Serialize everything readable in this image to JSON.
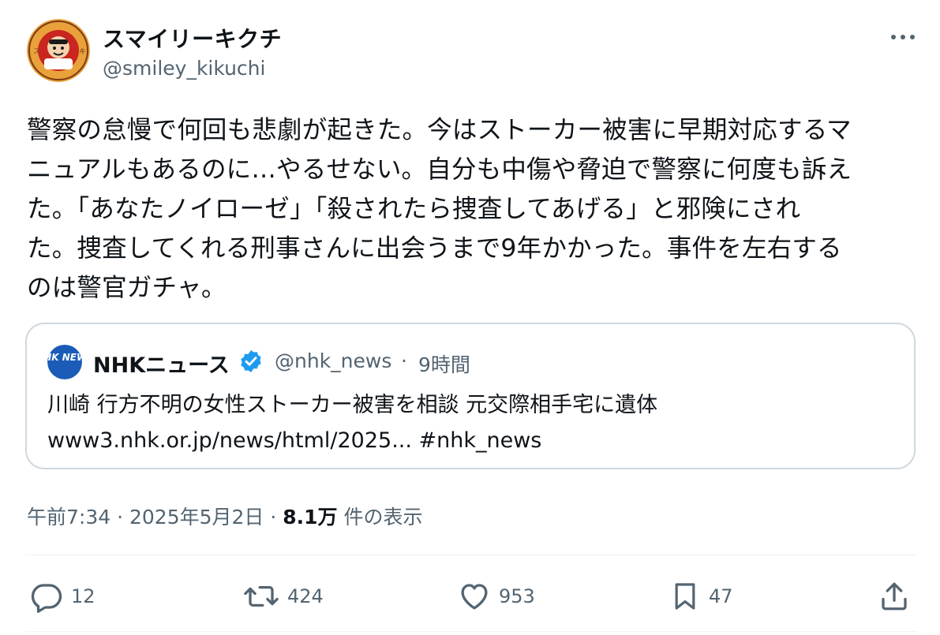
{
  "author": {
    "name": "スマイリーキクチ",
    "handle": "@smiley_kikuchi"
  },
  "tweet": {
    "text": "警察の怠慢で何回も悲劇が起きた。今はストーカー被害に早期対応するマ\nニュアルもあるのに…やるせない。自分も中傷や脅迫で警察に何度も訴え\nた。「あなたノイローゼ」「殺されたら捜査してあげる」と邪険にされ\nた。捜査してくれる刑事さんに出会うまで9年かかった。事件を左右する\nのは警官ガチャ。"
  },
  "quote": {
    "name": "NHKニュース",
    "handle": "@nhk_news",
    "separator": "·",
    "time": "9時間",
    "text": "川崎 行方不明の女性ストーカー被害を相談 元交際相手宅に遺体\nwww3.nhk.or.jp/news/html/2025... #nhk_news",
    "avatar_text": "NHK NEWS"
  },
  "meta": {
    "time": "午前7:34",
    "sep1": " · ",
    "date": "2025年5月2日",
    "sep2": " · ",
    "views_count": "8.1万",
    "views_label": " 件の表示"
  },
  "actions": {
    "reply_count": "12",
    "retweet_count": "424",
    "like_count": "953",
    "bookmark_count": "47"
  },
  "icons": {
    "more": "more-horizontal-icon",
    "verified": "verified-badge-icon",
    "reply": "reply-icon",
    "retweet": "retweet-icon",
    "like": "heart-icon",
    "bookmark": "bookmark-icon",
    "share": "share-icon"
  },
  "colors": {
    "text": "#0f1419",
    "secondary": "#536471",
    "border": "#cfd9de",
    "verified": "#1d9bf0",
    "nhk_blue": "#1a5cb8"
  }
}
